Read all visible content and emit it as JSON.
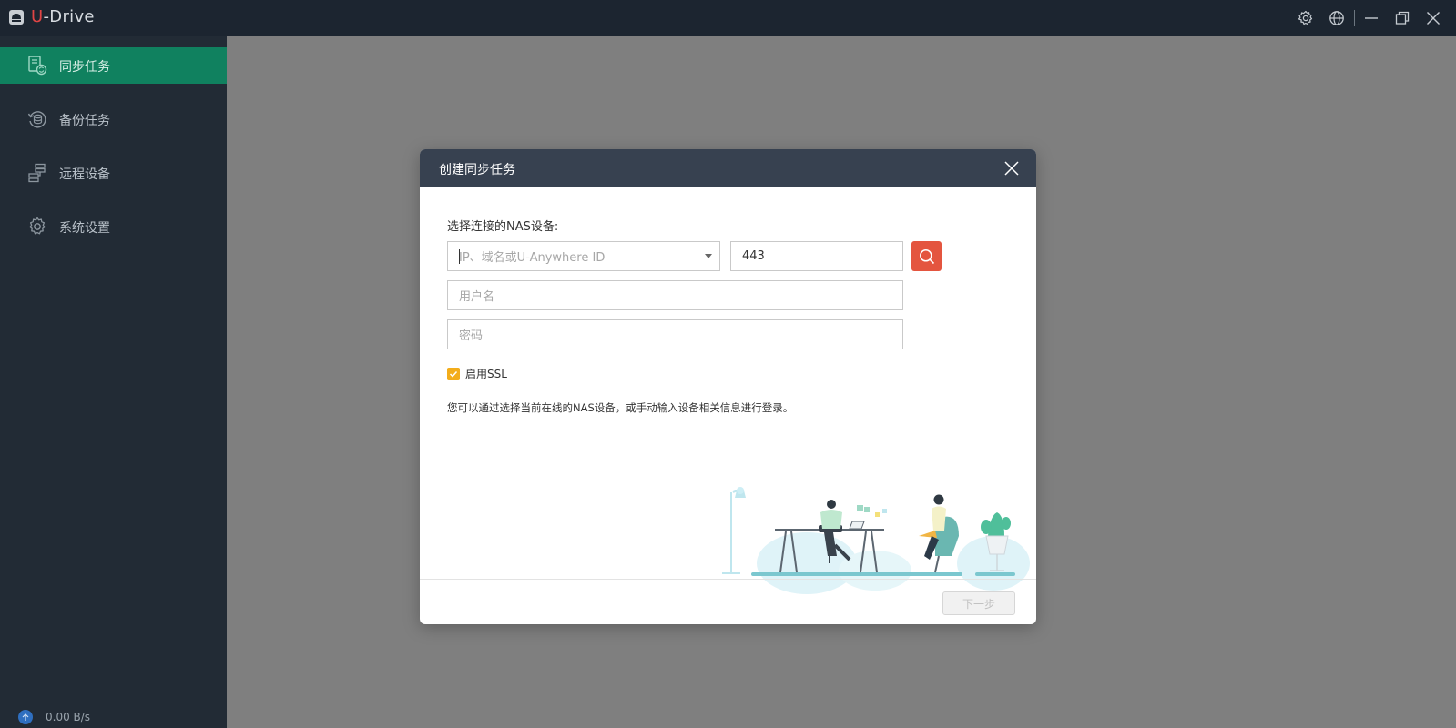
{
  "app": {
    "name_prefix": "U",
    "name_rest": "-Drive"
  },
  "sidebar": {
    "items": [
      {
        "label": "同步任务",
        "icon": "sync-task-icon",
        "active": true
      },
      {
        "label": "备份任务",
        "icon": "backup-task-icon",
        "active": false
      },
      {
        "label": "远程设备",
        "icon": "remote-device-icon",
        "active": false
      },
      {
        "label": "系统设置",
        "icon": "system-settings-icon",
        "active": false
      }
    ],
    "speed": "0.00 B/s"
  },
  "dialog": {
    "title": "创建同步任务",
    "device_label": "选择连接的NAS设备:",
    "host_placeholder": "IP、域名或U-Anywhere ID",
    "port_value": "443",
    "username_placeholder": "用户名",
    "password_placeholder": "密码",
    "ssl_label": "启用SSL",
    "ssl_checked": true,
    "hint": "您可以通过选择当前在线的NAS设备，或手动输入设备相关信息进行登录。",
    "next_label": "下一步"
  },
  "colors": {
    "titlebar": "#1c2530",
    "sidebar": "#222b35",
    "active_nav": "#10815f",
    "overlay": "#7f7f7f",
    "dialog_header": "#374150",
    "search_button": "#e4553f",
    "checkbox": "#f3ad1b"
  }
}
